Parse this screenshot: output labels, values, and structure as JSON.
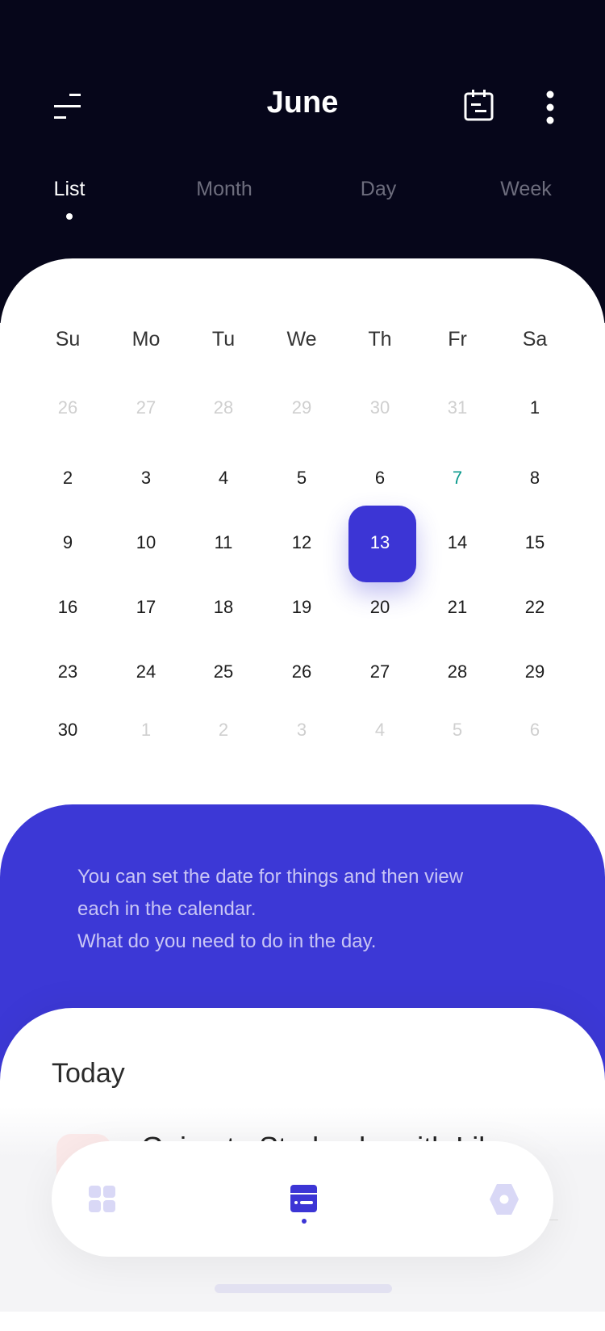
{
  "header": {
    "title": "June",
    "menu_icon": "menu-lines-icon",
    "calendar_icon": "calendar-icon",
    "more_icon": "more-vertical-icon"
  },
  "tabs": [
    {
      "label": "List",
      "active": true
    },
    {
      "label": "Month"
    },
    {
      "label": "Day"
    },
    {
      "label": "Week"
    }
  ],
  "calendar": {
    "weekdays": [
      "Su",
      "Mo",
      "Tu",
      "We",
      "Th",
      "Fr",
      "Sa"
    ],
    "weeks": [
      [
        {
          "d": "26",
          "m": 1
        },
        {
          "d": "27",
          "m": 1
        },
        {
          "d": "28",
          "m": 1
        },
        {
          "d": "29",
          "m": 1
        },
        {
          "d": "30",
          "m": 1
        },
        {
          "d": "31",
          "m": 1
        },
        {
          "d": "1"
        }
      ],
      [
        {
          "d": "2"
        },
        {
          "d": "3"
        },
        {
          "d": "4"
        },
        {
          "d": "5"
        },
        {
          "d": "6"
        },
        {
          "d": "7",
          "t": 1
        },
        {
          "d": "8"
        }
      ],
      [
        {
          "d": "9"
        },
        {
          "d": "10"
        },
        {
          "d": "11"
        },
        {
          "d": "12"
        },
        {
          "d": "13",
          "s": 1
        },
        {
          "d": "14"
        },
        {
          "d": "15"
        }
      ],
      [
        {
          "d": "16"
        },
        {
          "d": "17"
        },
        {
          "d": "18"
        },
        {
          "d": "19"
        },
        {
          "d": "20"
        },
        {
          "d": "21"
        },
        {
          "d": "22"
        }
      ],
      [
        {
          "d": "23"
        },
        {
          "d": "24"
        },
        {
          "d": "25"
        },
        {
          "d": "26"
        },
        {
          "d": "27"
        },
        {
          "d": "28"
        },
        {
          "d": "29"
        }
      ],
      [
        {
          "d": "30"
        },
        {
          "d": "1",
          "m": 1
        },
        {
          "d": "2",
          "m": 1
        },
        {
          "d": "3",
          "m": 1
        },
        {
          "d": "4",
          "m": 1
        },
        {
          "d": "5",
          "m": 1
        },
        {
          "d": "6",
          "m": 1
        }
      ]
    ],
    "selected": "13",
    "highlight": "7",
    "accent": "#3c35d5",
    "highlight_color": "#0b9a8d"
  },
  "info": {
    "lines": [
      "You can set the date for things and then view",
      "each in the calendar.",
      "What do you need to do in the day."
    ]
  },
  "today": {
    "title": "Today",
    "task": "Going to Starbucks with Lil"
  },
  "nav": {
    "items": [
      {
        "icon": "grid-icon"
      },
      {
        "icon": "calendar-card-icon",
        "active": true
      },
      {
        "icon": "settings-hex-icon"
      }
    ]
  }
}
